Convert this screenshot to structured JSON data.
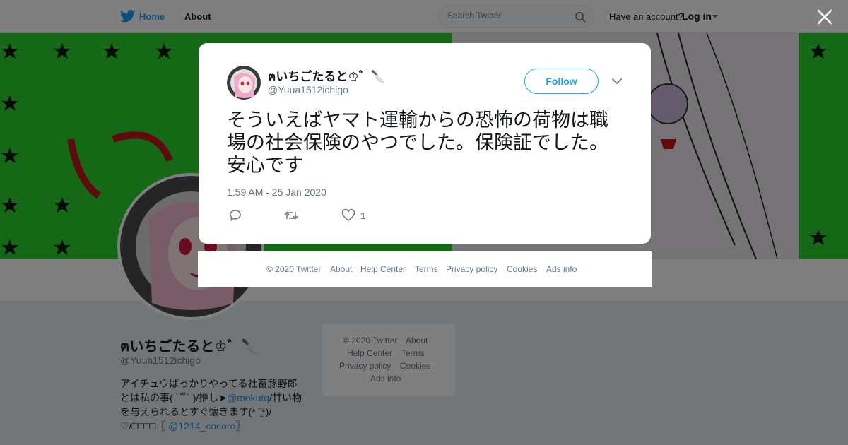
{
  "nav": {
    "home_label": "Home",
    "about_label": "About",
    "search_placeholder": "Search Twitter",
    "have_account": "Have an account?",
    "login_label": "Log in"
  },
  "profile": {
    "name": "ฅいちごたると♔゛🔪",
    "handle": "@Yuua1512ichigo",
    "bio_line1": "アイチュウばっかりやってる社畜豚野郎",
    "bio_line2_pre": "とは私の事( ˙꒳˙ )/推し➤",
    "bio_link1": "@mokutq",
    "bio_line2_post": "/甘い物",
    "bio_line3": "を与えられるとすぐ懐きます(* ¨̮*)/",
    "bio_line4_pre": "♡/□□□□〖 ",
    "bio_link2": "@1214_cocoro",
    "bio_line4_post": "〗"
  },
  "side_footer": {
    "copyright": "© 2020 Twitter",
    "about": "About",
    "help": "Help Center",
    "terms": "Terms",
    "privacy": "Privacy policy",
    "cookies": "Cookies",
    "ads": "Ads info"
  },
  "tweet": {
    "author_name": "ฅいちごたると♔゛🔪",
    "author_handle": "@Yuua1512ichigo",
    "follow_label": "Follow",
    "text": "そういえばヤマト運輸からの恐怖の荷物は職場の社会保険のやつでした。保険証でした。安心です",
    "timestamp": "1:59 AM - 25 Jan 2020",
    "like_count": "1"
  },
  "modal_footer": {
    "copyright": "© 2020 Twitter",
    "about": "About",
    "help": "Help Center",
    "terms": "Terms",
    "privacy": "Privacy policy",
    "cookies": "Cookies",
    "ads": "Ads info"
  },
  "colors": {
    "brand": "#1da1f2",
    "banner_green": "#2ad12a",
    "text_secondary": "#657786"
  },
  "icons": [
    "twitter-bird-icon",
    "search-icon",
    "caret-down-icon",
    "close-icon",
    "reply-icon",
    "retweet-icon",
    "heart-icon",
    "chevron-down-icon"
  ]
}
